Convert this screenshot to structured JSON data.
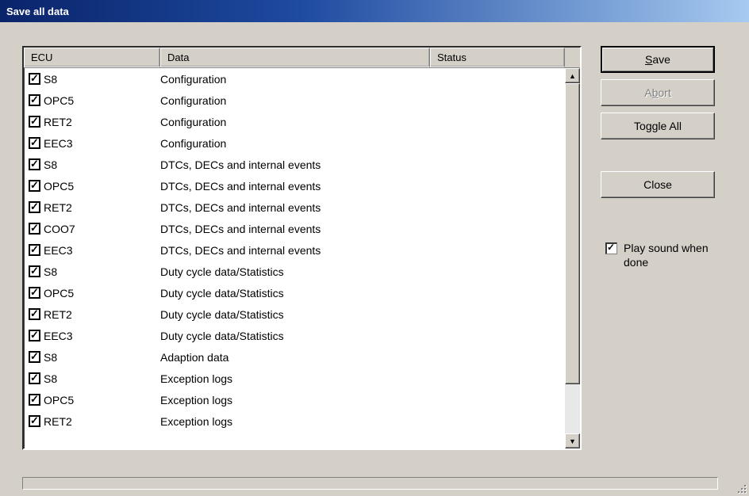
{
  "window": {
    "title": "Save all data"
  },
  "columns": {
    "ecu": "ECU",
    "data": "Data",
    "status": "Status"
  },
  "rows": [
    {
      "checked": true,
      "ecu": "S8",
      "data": "Configuration",
      "status": ""
    },
    {
      "checked": true,
      "ecu": "OPC5",
      "data": "Configuration",
      "status": ""
    },
    {
      "checked": true,
      "ecu": "RET2",
      "data": "Configuration",
      "status": ""
    },
    {
      "checked": true,
      "ecu": "EEC3",
      "data": "Configuration",
      "status": ""
    },
    {
      "checked": true,
      "ecu": "S8",
      "data": "DTCs, DECs and internal events",
      "status": ""
    },
    {
      "checked": true,
      "ecu": "OPC5",
      "data": "DTCs, DECs and internal events",
      "status": ""
    },
    {
      "checked": true,
      "ecu": "RET2",
      "data": "DTCs, DECs and internal events",
      "status": ""
    },
    {
      "checked": true,
      "ecu": "COO7",
      "data": "DTCs, DECs and internal events",
      "status": ""
    },
    {
      "checked": true,
      "ecu": "EEC3",
      "data": "DTCs, DECs and internal events",
      "status": ""
    },
    {
      "checked": true,
      "ecu": "S8",
      "data": "Duty cycle data/Statistics",
      "status": ""
    },
    {
      "checked": true,
      "ecu": "OPC5",
      "data": "Duty cycle data/Statistics",
      "status": ""
    },
    {
      "checked": true,
      "ecu": "RET2",
      "data": "Duty cycle data/Statistics",
      "status": ""
    },
    {
      "checked": true,
      "ecu": "EEC3",
      "data": "Duty cycle data/Statistics",
      "status": ""
    },
    {
      "checked": true,
      "ecu": "S8",
      "data": "Adaption data",
      "status": ""
    },
    {
      "checked": true,
      "ecu": "S8",
      "data": "Exception logs",
      "status": ""
    },
    {
      "checked": true,
      "ecu": "OPC5",
      "data": "Exception logs",
      "status": ""
    },
    {
      "checked": true,
      "ecu": "RET2",
      "data": "Exception logs",
      "status": ""
    }
  ],
  "buttons": {
    "save": {
      "pre": "",
      "ul": "S",
      "post": "ave",
      "disabled": false,
      "default": true
    },
    "abort": {
      "pre": "A",
      "ul": "b",
      "post": "ort",
      "disabled": true,
      "default": false
    },
    "toggle": {
      "label": "Toggle All"
    },
    "close": {
      "label": "Close"
    }
  },
  "playsound": {
    "checked": true,
    "label": "Play sound when done"
  }
}
